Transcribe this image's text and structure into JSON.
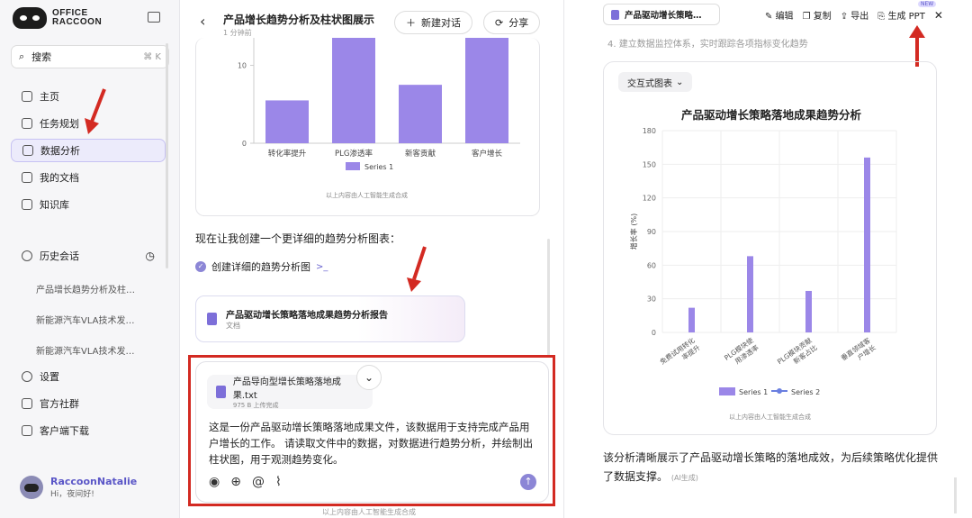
{
  "sidebar": {
    "logo_line1": "OFFICE",
    "logo_line2": "RACCOON",
    "search_label": "搜索",
    "search_shortcut": "⌘ K",
    "nav": [
      {
        "label": "主页",
        "icon": "home-icon"
      },
      {
        "label": "任务规划",
        "icon": "task-icon"
      },
      {
        "label": "数据分析",
        "icon": "chart-icon"
      },
      {
        "label": "我的文档",
        "icon": "doc-icon"
      },
      {
        "label": "知识库",
        "icon": "knowledge-icon"
      }
    ],
    "history_title": "历史会话",
    "history_items": [
      "产品增长趋势分析及柱…",
      "新能源汽车VLA技术发…",
      "新能源汽车VLA技术发…"
    ],
    "bottom_nav": [
      {
        "label": "设置",
        "icon": "settings-icon"
      },
      {
        "label": "官方社群",
        "icon": "community-icon"
      },
      {
        "label": "客户端下载",
        "icon": "download-icon"
      }
    ],
    "user_name": "RaccoonNatalie",
    "user_greeting": "Hi，夜间好!"
  },
  "chat": {
    "title": "产品增长趋势分析及柱状图展示",
    "subtitle": "1 分钟前",
    "new_chat_label": "新建对话",
    "share_label": "分享",
    "ai_note": "以上内容由人工智能生成合成",
    "message": "现在让我创建一个更详细的趋势分析图表：",
    "step_label": "创建详细的趋势分析图",
    "doc_title": "产品驱动增长策略落地成果趋势分析报告",
    "doc_type": "文档",
    "attachment_title": "产品导向型增长策略落地成果.txt",
    "attachment_sub": "975 B 上传完成",
    "input_text": "这是一份产品驱动增长策略落地成果文件，该数据用于支持完成产品用户增长的工作。 请读取文件中的数据，对数据进行趋势分析，并绘制出柱状图，用于观测趋势变化。",
    "bottom_note": "以上内容由人工智能生成合成"
  },
  "right": {
    "tab_title": "产品驱动增长策略…",
    "edit": "编辑",
    "copy": "复制",
    "export": "导出",
    "gen_ppt": "生成 PPT",
    "new_badge": "NEW",
    "faint_text": "4. 建立数据监控体系，实时跟踪各项指标变化趋势",
    "chip_label": "交互式图表",
    "ai_note": "以上内容由人工智能生成合成",
    "para": "该分析清晰展示了产品驱动增长策略的落地成效，为后续策略优化提供了数据支撑。",
    "para_ai": "(AI生成)"
  },
  "colors": {
    "accent": "#8c7ae6",
    "series1": "#9b87e8",
    "series2": "#6a7fe0",
    "annotation": "#d32a22"
  },
  "chart_data": [
    {
      "type": "bar",
      "categories": [
        "转化率提升",
        "PLG渗透率",
        "新客贡献",
        "客户增长"
      ],
      "series": [
        {
          "name": "Series 1",
          "values": [
            5.5,
            17,
            7.5,
            17
          ]
        }
      ],
      "yticks": [
        0,
        10
      ],
      "ylim": [
        0,
        17
      ],
      "legend": "bottom"
    },
    {
      "type": "bar",
      "title": "产品驱动增长策略落地成果趋势分析",
      "categories": [
        "免费试用转化率提升",
        "PLG模块使用渗透率",
        "PLG模块贡献新客占比",
        "垂直领域客户增长"
      ],
      "series": [
        {
          "name": "Series 1",
          "values": [
            22,
            68,
            37,
            156
          ]
        },
        {
          "name": "Series 2",
          "values": []
        }
      ],
      "ylabel": "增长率 (%)",
      "ylim": [
        0,
        180
      ],
      "yticks": [
        0,
        30,
        60,
        90,
        120,
        150,
        180
      ],
      "grid": true,
      "legend": "bottom"
    }
  ]
}
